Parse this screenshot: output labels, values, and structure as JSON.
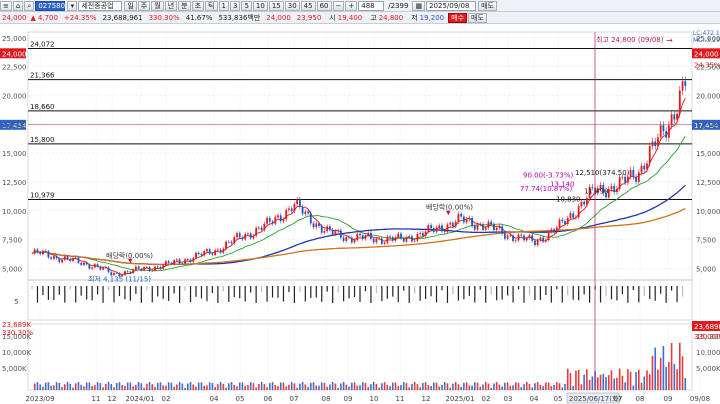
{
  "toolbar": {
    "stock_code": "027580",
    "stock_name": "세진중공업",
    "period_buttons": [
      "주",
      "월",
      "년",
      "분",
      "초",
      "틱"
    ],
    "interval_buttons": [
      "1",
      "3",
      "5",
      "10",
      "15",
      "30",
      "45",
      "60"
    ],
    "display_count": "488",
    "total_count": "/2399",
    "date": "2025/09/08",
    "more_button": "매도",
    "price": "24,000",
    "change": "4,700",
    "change_rate": "+24.35%",
    "volume": "23,688,961",
    "volume_ratio": "330.30%",
    "turnover": "41.67%",
    "amount": "533,836백만",
    "open_label": "시",
    "open": "24,000",
    "prev_close": "23,950",
    "high_label": "고",
    "high": "19,400",
    "low_label": "저",
    "low": "24,800",
    "close": "19,200",
    "buy_button": "매수",
    "sell_button": "매도"
  },
  "chart": {
    "colors": {
      "up": "#e0191c",
      "down": "#1b55c7",
      "ma5": "#e0191c",
      "ma20": "#2aa02a",
      "ma60": "#2233aa",
      "ma120": "#d0731a",
      "resistance": "#111111",
      "marker": "#c2185b",
      "annot": "#b000b0"
    },
    "y_axis_labels": [
      "25,000",
      "22,500",
      "20,000",
      "17,500",
      "15,000",
      "12,500",
      "10,000",
      "7,500",
      "5,000"
    ],
    "x_axis_labels": [
      "2023/09",
      "11",
      "12",
      "2024/01",
      "02",
      "04",
      "05",
      "06",
      "07",
      "08",
      "09",
      "10",
      "11",
      "12",
      "2025/01",
      "02",
      "03",
      "04",
      "05",
      "2025/06/17(화)",
      "07",
      "08",
      "09",
      "09/08"
    ],
    "current_price_tag": "24,000",
    "current_rate_tag": "24.35%",
    "crosshair_price_tag": "17,454",
    "lc_label": "LC:472.1",
    "mc_label": "MC:-3.29",
    "volume_labels": [
      "15,000K",
      "10,000K",
      "5,000K"
    ],
    "volume_tag": "23,689K",
    "volume_ratio_tag": "330.30%",
    "levels": [
      {
        "label": "24,072",
        "value": 24072
      },
      {
        "label": "21,366",
        "value": 21366
      },
      {
        "label": "18,660",
        "value": 18660
      },
      {
        "label": "15,800",
        "value": 15800
      },
      {
        "label": "10,979",
        "value": 10979
      }
    ],
    "annotations": {
      "high_note": "최고 24,800 (09/08)",
      "low_note": "최저 4,135 (11/15)",
      "ex_div_1": "배당락(0.00%)",
      "ex_div_2": "배당락(0.00%)",
      "note_a": "90.00(-3.73%)",
      "note_b": "12,510(374.50)",
      "note_c": "13,140",
      "note_d": "77.74(10.87%)",
      "note_e": "10,830",
      "note_f": "11,490"
    }
  },
  "chart_data": {
    "type": "candlestick",
    "title": "",
    "ylim": [
      4000,
      25500
    ],
    "series": [
      {
        "name": "price",
        "x": [
          "2023/09",
          "11",
          "12",
          "2024/01",
          "02",
          "04",
          "05",
          "06",
          "07",
          "08",
          "09",
          "10",
          "11",
          "12",
          "2025/01",
          "02",
          "03",
          "04",
          "05",
          "06",
          "07",
          "08",
          "09",
          "09/08"
        ],
        "values": [
          6300,
          5200,
          4500,
          4900,
          5300,
          6500,
          7700,
          8800,
          10500,
          8200,
          7700,
          7600,
          7500,
          8100,
          9200,
          8700,
          7900,
          7300,
          8500,
          11800,
          12100,
          13600,
          17500,
          24000
        ]
      }
    ]
  }
}
